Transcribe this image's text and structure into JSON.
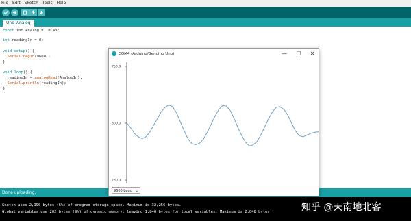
{
  "menu": [
    "File",
    "Edit",
    "Sketch",
    "Tools",
    "Help"
  ],
  "toolbar": {
    "icons": [
      "verify-icon",
      "upload-icon",
      "new-icon",
      "open-icon",
      "save-icon"
    ]
  },
  "tab": {
    "label": "Uno_Analog"
  },
  "code": {
    "l1a": "const",
    "l1b": " int AnalogIn  = A0;",
    "l2a": "int",
    "l2b": " readingIn = 0;",
    "l3a": "void",
    "l3b": " ",
    "l3c": "setup",
    "l3d": "() {",
    "l4a": "  ",
    "l4b": "Serial",
    "l4c": ".",
    "l4d": "begin",
    "l4e": "(9600);",
    "l5": "}",
    "l6a": "void",
    "l6b": " ",
    "l6c": "loop",
    "l6d": "() {",
    "l7a": "  readingIn = ",
    "l7b": "analogRead",
    "l7c": "(AnalogIn);",
    "l8a": "  ",
    "l8b": "Serial",
    "l8c": ".",
    "l8d": "println",
    "l8e": "(readingIn);",
    "l9": "}"
  },
  "status": "Done uploading.",
  "console": [
    "Sketch uses 2,190 bytes (6%) of program storage space. Maximum is 32,256 bytes.",
    "Global variables use 202 bytes (9%) of dynamic memory, leaving 1,846 bytes for local variables. Maximum is 2,048 bytes."
  ],
  "plotter": {
    "title": "COM4 (Arduino/Genuino Uno)",
    "minimize": "—",
    "maximize": "☐",
    "close": "✕",
    "baud": "9600 baud",
    "line_color": "#6fa0c8"
  },
  "chart_data": {
    "type": "line",
    "ylim": [
      250,
      750
    ],
    "yticks": [
      "750.0",
      "500.0",
      "250.0"
    ],
    "ytick_values": [
      750,
      500,
      250
    ],
    "series": [
      {
        "values": [
          500,
          480,
          455,
          440,
          432,
          440,
          460,
          490,
          520,
          550,
          570,
          580,
          572,
          545,
          505,
          465,
          430,
          410,
          405,
          412,
          430,
          460,
          495,
          530,
          560,
          577,
          575,
          555,
          520,
          480,
          445,
          415,
          400,
          405,
          420,
          450,
          485,
          520,
          550,
          570,
          572,
          560,
          535,
          500,
          465,
          445,
          440,
          448,
          455,
          460,
          462
        ]
      }
    ]
  },
  "watermark": "知乎 @天南地北客"
}
